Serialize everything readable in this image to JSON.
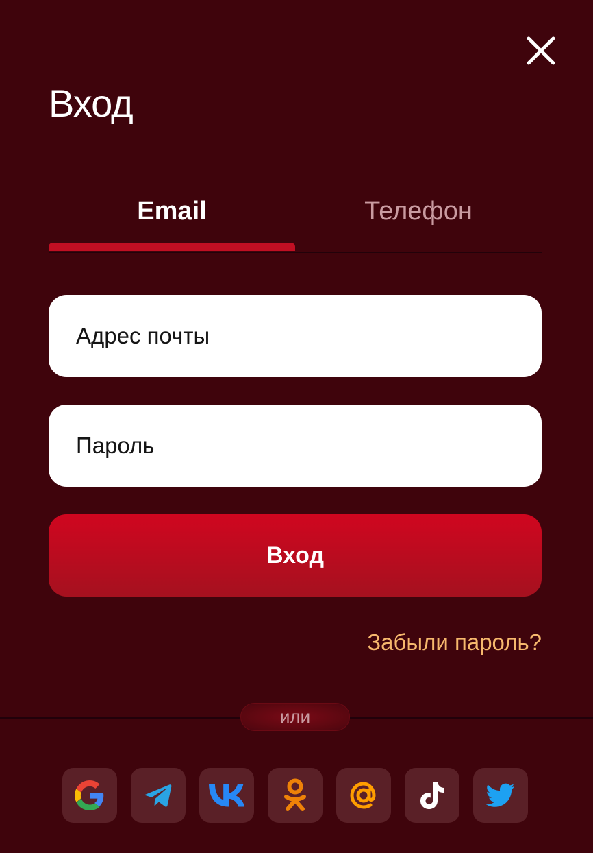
{
  "modal": {
    "title": "Вход",
    "close_icon": "close-icon"
  },
  "tabs": [
    {
      "label": "Email",
      "active": true
    },
    {
      "label": "Телефон",
      "active": false
    }
  ],
  "form": {
    "email_placeholder": "Адрес почты",
    "password_placeholder": "Пароль",
    "submit_label": "Вход",
    "forgot_label": "Забыли пароль?"
  },
  "divider": {
    "label": "или"
  },
  "socials": [
    {
      "name": "google-icon"
    },
    {
      "name": "telegram-icon"
    },
    {
      "name": "vk-icon"
    },
    {
      "name": "odnoklassniki-icon"
    },
    {
      "name": "mail-ru-icon"
    },
    {
      "name": "tiktok-icon"
    },
    {
      "name": "twitter-icon"
    }
  ],
  "colors": {
    "background": "#3f040c",
    "accent": "#c10f23",
    "link": "#f6b86d",
    "inactive_tab": "#c99ba1"
  }
}
